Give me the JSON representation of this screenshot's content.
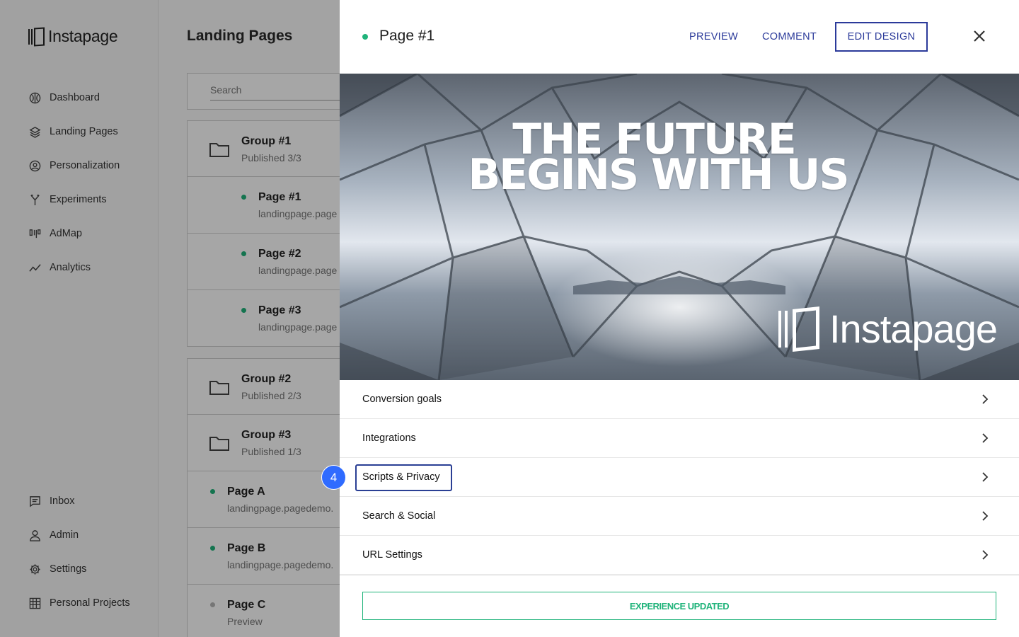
{
  "brand": {
    "name": "Instapage"
  },
  "sidebar": {
    "items": [
      {
        "label": "Dashboard",
        "icon": "dashboard-icon"
      },
      {
        "label": "Landing Pages",
        "icon": "layers-icon"
      },
      {
        "label": "Personalization",
        "icon": "user-circle-icon"
      },
      {
        "label": "Experiments",
        "icon": "split-icon"
      },
      {
        "label": "AdMap",
        "icon": "admap-icon"
      },
      {
        "label": "Analytics",
        "icon": "analytics-icon"
      }
    ],
    "bottom_items": [
      {
        "label": "Inbox",
        "icon": "inbox-icon"
      },
      {
        "label": "Admin",
        "icon": "person-icon"
      },
      {
        "label": "Settings",
        "icon": "gear-icon"
      },
      {
        "label": "Personal Projects",
        "icon": "building-icon"
      }
    ]
  },
  "main": {
    "title": "Landing Pages",
    "search_placeholder": "Search",
    "rows": [
      {
        "type": "group",
        "name": "Group #1",
        "sub": "Published 3/3"
      },
      {
        "type": "page",
        "name": "Page #1",
        "sub": "landingpage.page"
      },
      {
        "type": "page",
        "name": "Page #2",
        "sub": "landingpage.page"
      },
      {
        "type": "page",
        "name": "Page #3",
        "sub": "landingpage.page"
      },
      {
        "type": "group",
        "name": "Group #2",
        "sub": "Published 2/3"
      },
      {
        "type": "group",
        "name": "Group #3",
        "sub": "Published 1/3"
      },
      {
        "type": "page",
        "name": "Page A",
        "sub": "landingpage.pagedemo."
      },
      {
        "type": "page",
        "name": "Page B",
        "sub": "landingpage.pagedemo."
      },
      {
        "type": "page",
        "name": "Page C",
        "sub": "Preview"
      }
    ]
  },
  "drawer": {
    "title": "Page #1",
    "actions": {
      "preview": "PREVIEW",
      "comment": "COMMENT",
      "edit": "EDIT DESIGN"
    },
    "hero": {
      "line1": "THE FUTURE",
      "line2": "BEGINS WITH US",
      "brand": "Instapage"
    },
    "settings": [
      {
        "label": "Conversion goals"
      },
      {
        "label": "Integrations"
      },
      {
        "label": "Scripts & Privacy"
      },
      {
        "label": "Search & Social"
      },
      {
        "label": "URL Settings"
      }
    ],
    "step_badge": "4",
    "update_status": "EXPERIENCE UPDATED"
  },
  "colors": {
    "accent": "#2b3a9a",
    "success": "#1fb37a",
    "badge": "#2f6bff"
  }
}
